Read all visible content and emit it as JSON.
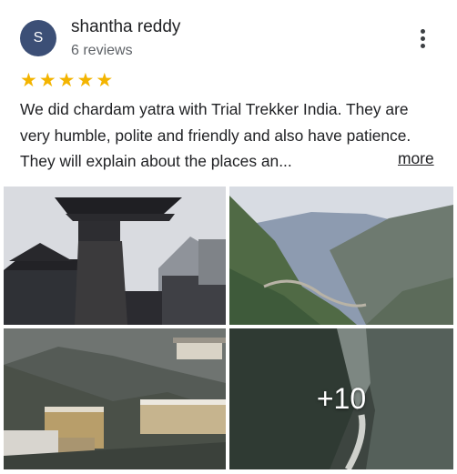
{
  "reviewer": {
    "initial": "S",
    "name": "shantha reddy",
    "reviews": "6 reviews"
  },
  "rating": {
    "stars": 5,
    "max": 5
  },
  "review": {
    "text": "We did chardam yatra with Trial Trekker India. They are very humble, polite and friendly and also have patience.  They will explain about the places an...",
    "more_label": "more"
  },
  "photos": [
    {
      "icon": "temple-photo"
    },
    {
      "icon": "valley-photo"
    },
    {
      "icon": "village-photo"
    },
    {
      "icon": "river-gorge-photo",
      "overlay_count": "+10"
    }
  ],
  "colors": {
    "star": "#f3b400",
    "avatar": "#3c4f76",
    "text": "#202124",
    "secondary": "#5f6368"
  }
}
